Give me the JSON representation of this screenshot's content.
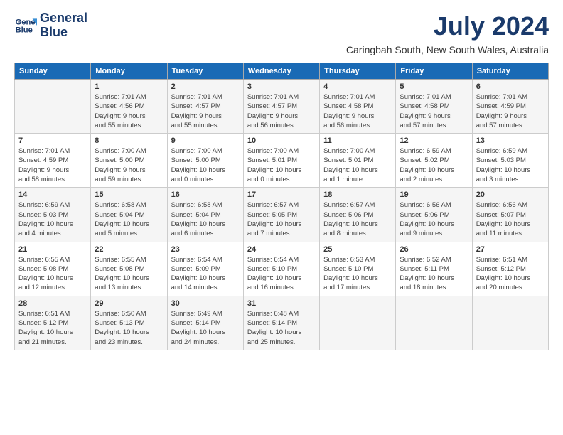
{
  "logo": {
    "line1": "General",
    "line2": "Blue"
  },
  "month": "July 2024",
  "location": "Caringbah South, New South Wales, Australia",
  "days_of_week": [
    "Sunday",
    "Monday",
    "Tuesday",
    "Wednesday",
    "Thursday",
    "Friday",
    "Saturday"
  ],
  "weeks": [
    [
      {
        "num": "",
        "info": ""
      },
      {
        "num": "1",
        "info": "Sunrise: 7:01 AM\nSunset: 4:56 PM\nDaylight: 9 hours\nand 55 minutes."
      },
      {
        "num": "2",
        "info": "Sunrise: 7:01 AM\nSunset: 4:57 PM\nDaylight: 9 hours\nand 55 minutes."
      },
      {
        "num": "3",
        "info": "Sunrise: 7:01 AM\nSunset: 4:57 PM\nDaylight: 9 hours\nand 56 minutes."
      },
      {
        "num": "4",
        "info": "Sunrise: 7:01 AM\nSunset: 4:58 PM\nDaylight: 9 hours\nand 56 minutes."
      },
      {
        "num": "5",
        "info": "Sunrise: 7:01 AM\nSunset: 4:58 PM\nDaylight: 9 hours\nand 57 minutes."
      },
      {
        "num": "6",
        "info": "Sunrise: 7:01 AM\nSunset: 4:59 PM\nDaylight: 9 hours\nand 57 minutes."
      }
    ],
    [
      {
        "num": "7",
        "info": "Sunrise: 7:01 AM\nSunset: 4:59 PM\nDaylight: 9 hours\nand 58 minutes."
      },
      {
        "num": "8",
        "info": "Sunrise: 7:00 AM\nSunset: 5:00 PM\nDaylight: 9 hours\nand 59 minutes."
      },
      {
        "num": "9",
        "info": "Sunrise: 7:00 AM\nSunset: 5:00 PM\nDaylight: 10 hours\nand 0 minutes."
      },
      {
        "num": "10",
        "info": "Sunrise: 7:00 AM\nSunset: 5:01 PM\nDaylight: 10 hours\nand 0 minutes."
      },
      {
        "num": "11",
        "info": "Sunrise: 7:00 AM\nSunset: 5:01 PM\nDaylight: 10 hours\nand 1 minute."
      },
      {
        "num": "12",
        "info": "Sunrise: 6:59 AM\nSunset: 5:02 PM\nDaylight: 10 hours\nand 2 minutes."
      },
      {
        "num": "13",
        "info": "Sunrise: 6:59 AM\nSunset: 5:03 PM\nDaylight: 10 hours\nand 3 minutes."
      }
    ],
    [
      {
        "num": "14",
        "info": "Sunrise: 6:59 AM\nSunset: 5:03 PM\nDaylight: 10 hours\nand 4 minutes."
      },
      {
        "num": "15",
        "info": "Sunrise: 6:58 AM\nSunset: 5:04 PM\nDaylight: 10 hours\nand 5 minutes."
      },
      {
        "num": "16",
        "info": "Sunrise: 6:58 AM\nSunset: 5:04 PM\nDaylight: 10 hours\nand 6 minutes."
      },
      {
        "num": "17",
        "info": "Sunrise: 6:57 AM\nSunset: 5:05 PM\nDaylight: 10 hours\nand 7 minutes."
      },
      {
        "num": "18",
        "info": "Sunrise: 6:57 AM\nSunset: 5:06 PM\nDaylight: 10 hours\nand 8 minutes."
      },
      {
        "num": "19",
        "info": "Sunrise: 6:56 AM\nSunset: 5:06 PM\nDaylight: 10 hours\nand 9 minutes."
      },
      {
        "num": "20",
        "info": "Sunrise: 6:56 AM\nSunset: 5:07 PM\nDaylight: 10 hours\nand 11 minutes."
      }
    ],
    [
      {
        "num": "21",
        "info": "Sunrise: 6:55 AM\nSunset: 5:08 PM\nDaylight: 10 hours\nand 12 minutes."
      },
      {
        "num": "22",
        "info": "Sunrise: 6:55 AM\nSunset: 5:08 PM\nDaylight: 10 hours\nand 13 minutes."
      },
      {
        "num": "23",
        "info": "Sunrise: 6:54 AM\nSunset: 5:09 PM\nDaylight: 10 hours\nand 14 minutes."
      },
      {
        "num": "24",
        "info": "Sunrise: 6:54 AM\nSunset: 5:10 PM\nDaylight: 10 hours\nand 16 minutes."
      },
      {
        "num": "25",
        "info": "Sunrise: 6:53 AM\nSunset: 5:10 PM\nDaylight: 10 hours\nand 17 minutes."
      },
      {
        "num": "26",
        "info": "Sunrise: 6:52 AM\nSunset: 5:11 PM\nDaylight: 10 hours\nand 18 minutes."
      },
      {
        "num": "27",
        "info": "Sunrise: 6:51 AM\nSunset: 5:12 PM\nDaylight: 10 hours\nand 20 minutes."
      }
    ],
    [
      {
        "num": "28",
        "info": "Sunrise: 6:51 AM\nSunset: 5:12 PM\nDaylight: 10 hours\nand 21 minutes."
      },
      {
        "num": "29",
        "info": "Sunrise: 6:50 AM\nSunset: 5:13 PM\nDaylight: 10 hours\nand 23 minutes."
      },
      {
        "num": "30",
        "info": "Sunrise: 6:49 AM\nSunset: 5:14 PM\nDaylight: 10 hours\nand 24 minutes."
      },
      {
        "num": "31",
        "info": "Sunrise: 6:48 AM\nSunset: 5:14 PM\nDaylight: 10 hours\nand 25 minutes."
      },
      {
        "num": "",
        "info": ""
      },
      {
        "num": "",
        "info": ""
      },
      {
        "num": "",
        "info": ""
      }
    ]
  ]
}
